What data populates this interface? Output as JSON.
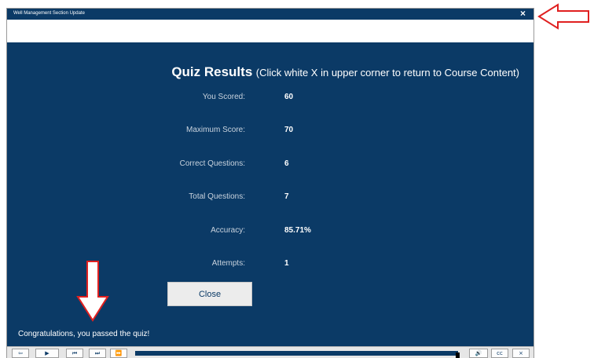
{
  "window": {
    "title": "Well Management Section Update",
    "close_symbol": "×"
  },
  "quiz": {
    "title": "Quiz Results",
    "subtitle": "(Click white X in upper corner to return to Course Content)",
    "rows": [
      {
        "label": "You Scored:",
        "value": "60"
      },
      {
        "label": "Maximum Score:",
        "value": "70"
      },
      {
        "label": "Correct Questions:",
        "value": "6"
      },
      {
        "label": "Total Questions:",
        "value": "7"
      },
      {
        "label": "Accuracy:",
        "value": "85.71%"
      },
      {
        "label": "Attempts:",
        "value": "1"
      }
    ],
    "close_label": "Close",
    "message": "Congratulations, you passed the quiz!"
  },
  "controls": {
    "exit_symbol": "⇦",
    "play_symbol": "▶",
    "prev_symbol": "⏮",
    "next_symbol": "⏭",
    "ff_symbol": "⏩",
    "volume_symbol": "🔊",
    "cc_label": "cc",
    "close_symbol": "×",
    "progress_fraction": 0.99
  },
  "colors": {
    "brand_navy": "#0b3a66",
    "annotation_red": "#e02020"
  }
}
